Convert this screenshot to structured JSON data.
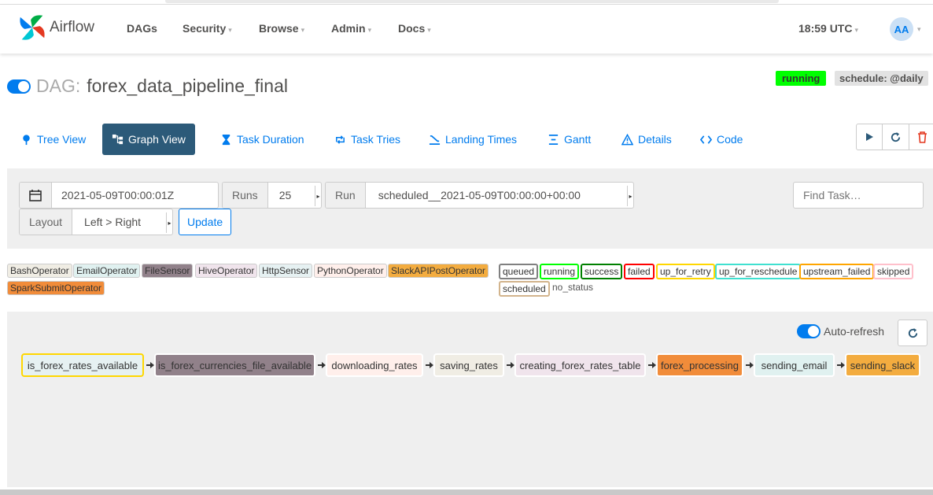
{
  "nav": {
    "brand": "Airflow",
    "items": [
      "DAGs",
      "Security",
      "Browse",
      "Admin",
      "Docs"
    ],
    "clock": "18:59 UTC",
    "avatar": "AA"
  },
  "dag": {
    "prefix": "DAG:",
    "name": "forex_data_pipeline_final",
    "state": "running",
    "schedule": "schedule: @daily"
  },
  "tabs": [
    "Tree View",
    "Graph View",
    "Task Duration",
    "Task Tries",
    "Landing Times",
    "Gantt",
    "Details",
    "Code"
  ],
  "active_tab": "Graph View",
  "filters": {
    "date": "2021-05-09T00:00:01Z",
    "runs_label": "Runs",
    "runs_value": "25",
    "run_label": "Run",
    "run_value": "scheduled__2021-05-09T00:00:00+00:00",
    "layout_label": "Layout",
    "layout_value": "Left > Right",
    "update_label": "Update",
    "find_placeholder": "Find Task…"
  },
  "operators": [
    {
      "name": "BashOperator",
      "color": "#f0ede4"
    },
    {
      "name": "EmailOperator",
      "color": "#e0f1f0"
    },
    {
      "name": "FileSensor",
      "color": "#91818a"
    },
    {
      "name": "HiveOperator",
      "color": "#f0e4ec"
    },
    {
      "name": "HttpSensor",
      "color": "#e6f1f2"
    },
    {
      "name": "PythonOperator",
      "color": "#ffefeb"
    },
    {
      "name": "SlackAPIPostOperator",
      "color": "#f3ac3f"
    },
    {
      "name": "SparkSubmitOperator",
      "color": "#f18c3a"
    }
  ],
  "states": [
    {
      "name": "queued",
      "border": "#808080"
    },
    {
      "name": "running",
      "border": "#00ff00"
    },
    {
      "name": "success",
      "border": "#008000"
    },
    {
      "name": "failed",
      "border": "#ff0000"
    },
    {
      "name": "up_for_retry",
      "border": "#ffd700"
    },
    {
      "name": "up_for_reschedule",
      "border": "#40e0d0"
    },
    {
      "name": "upstream_failed",
      "border": "#ffa500"
    },
    {
      "name": "skipped",
      "border": "#ffc0cb"
    },
    {
      "name": "scheduled",
      "border": "#d2b48c"
    }
  ],
  "no_status_label": "no_status",
  "graph": {
    "autorefresh_label": "Auto-refresh",
    "nodes": [
      {
        "name": "is_forex_rates_available",
        "operator": "HttpSensor",
        "fill": "#e6f1f2",
        "border": "#ffd700"
      },
      {
        "name": "is_forex_currencies_file_available",
        "operator": "FileSensor",
        "fill": "#91818a",
        "border": "#ffffff"
      },
      {
        "name": "downloading_rates",
        "operator": "PythonOperator",
        "fill": "#ffefeb",
        "border": "#ffffff"
      },
      {
        "name": "saving_rates",
        "operator": "BashOperator",
        "fill": "#f0ede4",
        "border": "#ffffff"
      },
      {
        "name": "creating_forex_rates_table",
        "operator": "HiveOperator",
        "fill": "#f0e4ec",
        "border": "#ffffff"
      },
      {
        "name": "forex_processing",
        "operator": "SparkSubmitOperator",
        "fill": "#f18c3a",
        "border": "#ffffff"
      },
      {
        "name": "sending_email",
        "operator": "EmailOperator",
        "fill": "#e0f1f0",
        "border": "#ffffff"
      },
      {
        "name": "sending_slack",
        "operator": "SlackAPIPostOperator",
        "fill": "#f3ac3f",
        "border": "#ffffff"
      }
    ]
  }
}
